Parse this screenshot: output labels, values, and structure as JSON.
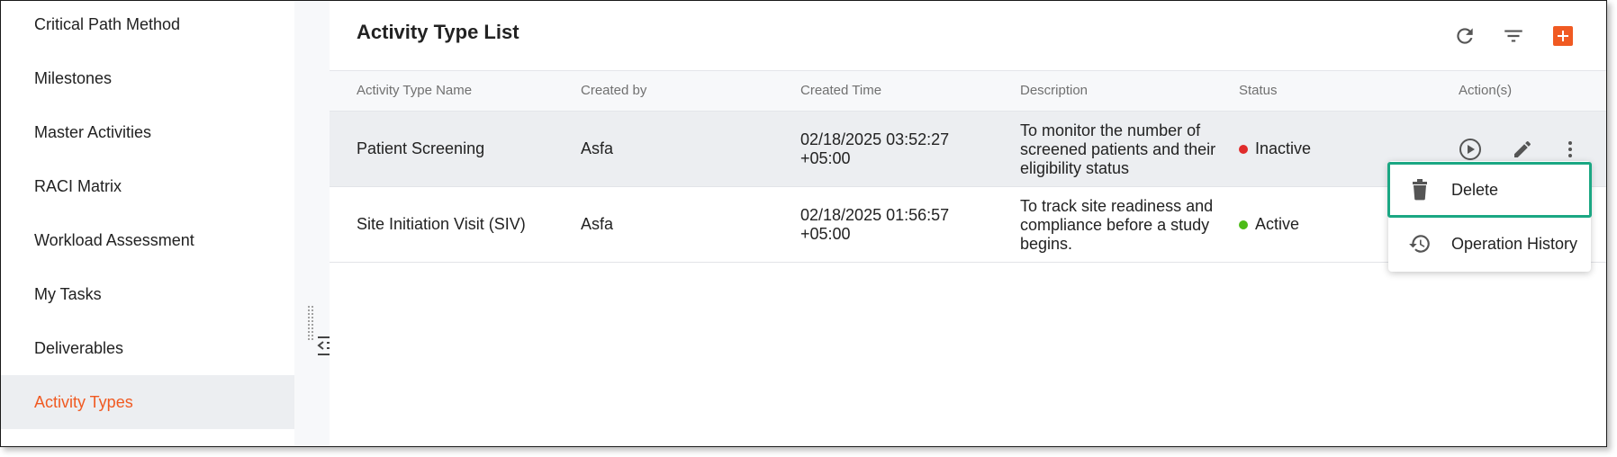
{
  "sidebar": {
    "items": [
      {
        "label": "Critical Path Method"
      },
      {
        "label": "Milestones"
      },
      {
        "label": "Master Activities"
      },
      {
        "label": "RACI Matrix"
      },
      {
        "label": "Workload Assessment"
      },
      {
        "label": "My Tasks"
      },
      {
        "label": "Deliverables"
      },
      {
        "label": "Activity Types"
      }
    ],
    "active_item": "Activity Types",
    "active_color": "#f05a22",
    "collapse_icon": "collapse-sidebar-icon"
  },
  "main": {
    "title": "Activity Type List",
    "toolbar": {
      "refresh_icon": "refresh-icon",
      "filter_icon": "filter-icon",
      "add_icon": "add-icon",
      "add_color": "#f05a22"
    },
    "table": {
      "columns": [
        "Activity Type Name",
        "Created by",
        "Created Time",
        "Description",
        "Status",
        "Action(s)"
      ],
      "rows": [
        {
          "name": "Patient Screening",
          "created_by": "Asfa",
          "created_time_line1": "02/18/2025 03:52:27",
          "created_time_line2": "+05:00",
          "description_line1": "To monitor the number of",
          "description_line2": "screened patients and their",
          "description_line3": "eligibility status",
          "status": "Inactive",
          "status_color": "#e02b2b"
        },
        {
          "name": "Site Initiation Visit (SIV)",
          "created_by": "Asfa",
          "created_time_line1": "02/18/2025 01:56:57",
          "created_time_line2": "+05:00",
          "description_line1": "To track site readiness and",
          "description_line2": "compliance before a study",
          "description_line3": "begins.",
          "status": "Active",
          "status_color": "#4cbb17"
        }
      ]
    },
    "row_actions": [
      "play-circle-icon",
      "edit-icon",
      "more-vertical-icon"
    ]
  },
  "context_menu": {
    "items": [
      {
        "label": "Delete",
        "icon": "trash-icon"
      },
      {
        "label": "Operation History",
        "icon": "history-icon"
      }
    ],
    "highlight_color": "#1ba783"
  }
}
